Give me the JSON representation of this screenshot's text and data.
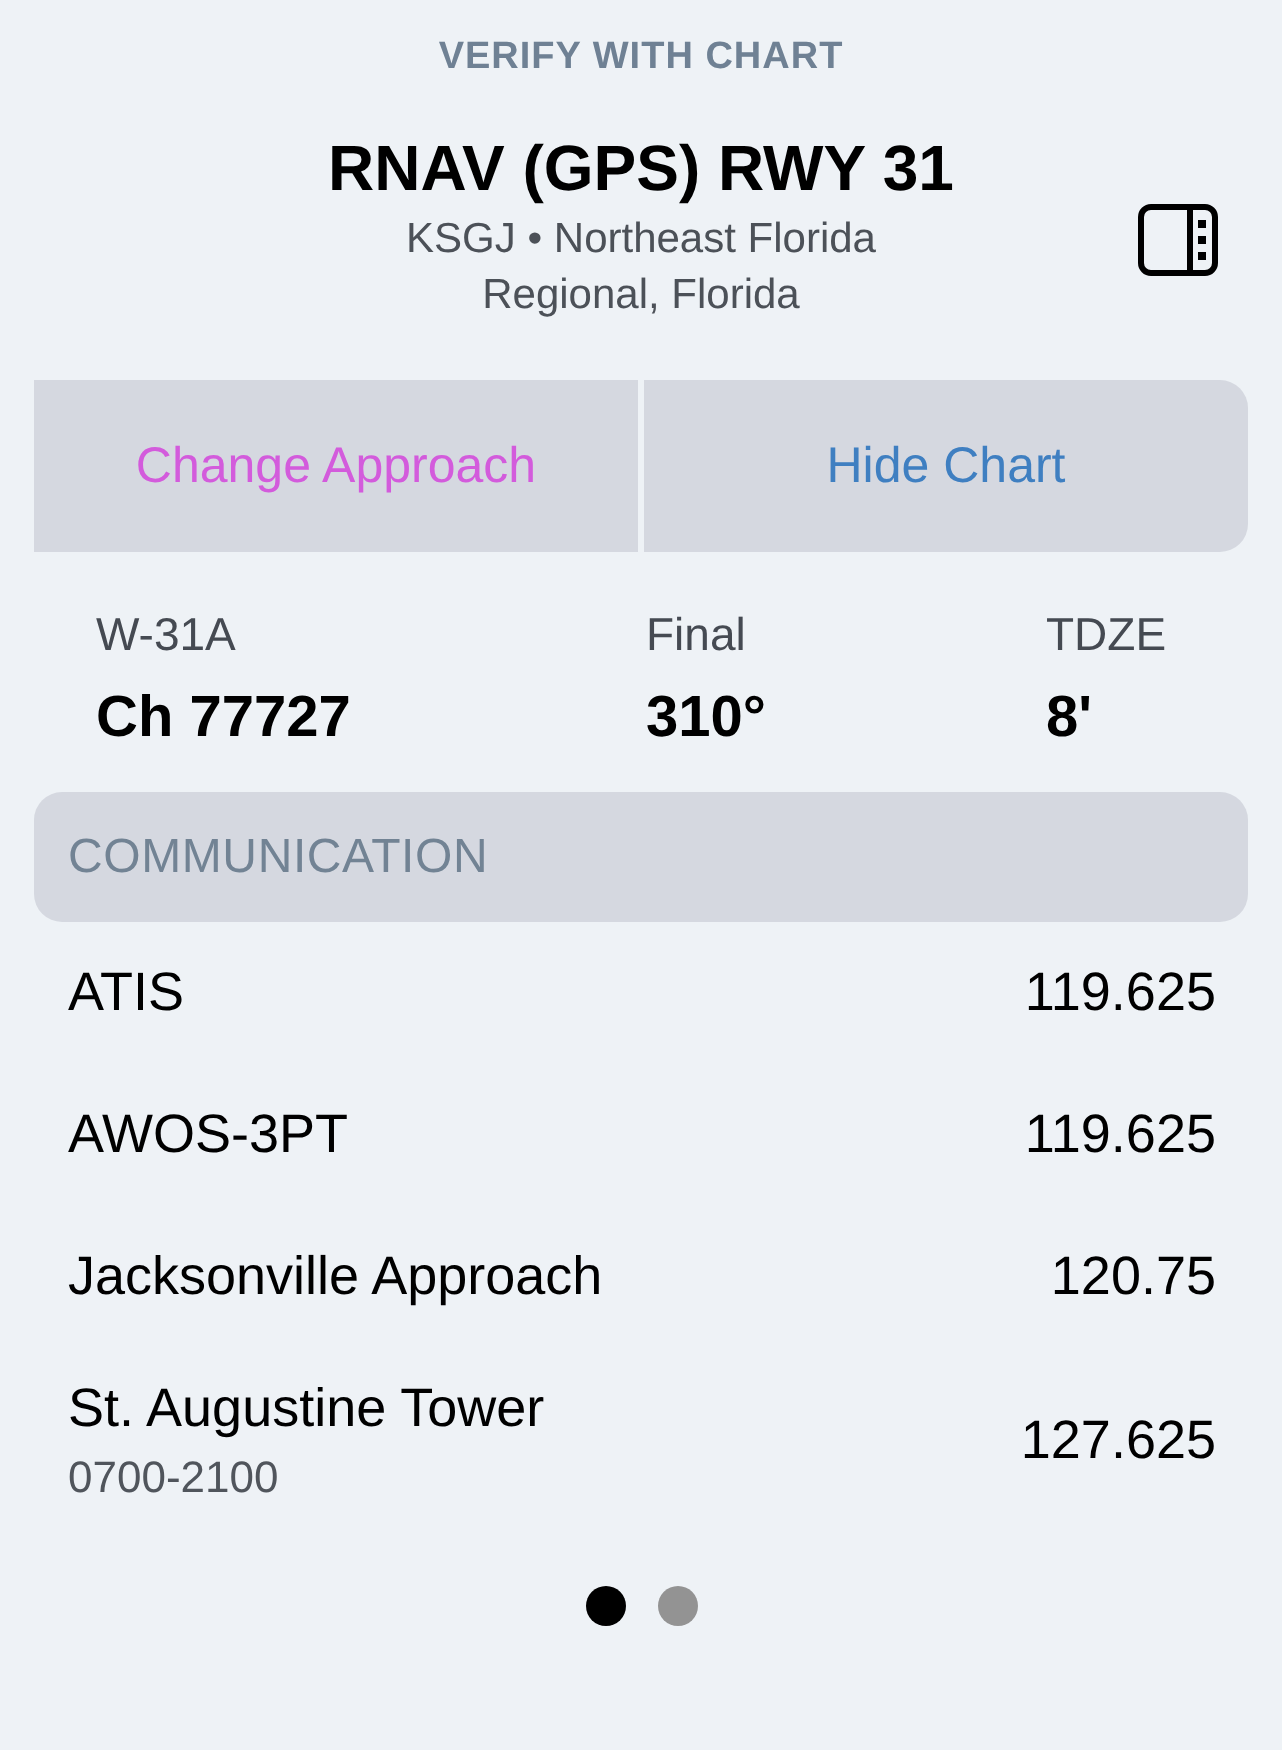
{
  "header": {
    "notice": "VERIFY WITH CHART",
    "title": "RNAV (GPS) RWY 31",
    "subtitle": "KSGJ • Northeast Florida Regional, Florida"
  },
  "actions": [
    {
      "label": "Change Approach",
      "color": "#d35bdc"
    },
    {
      "label": "Hide Chart",
      "color": "#3f7fc1"
    }
  ],
  "info": [
    {
      "label": "W-31A",
      "value": "Ch 77727"
    },
    {
      "label": "Final",
      "value": "310°"
    },
    {
      "label": "TDZE",
      "value": "8'"
    }
  ],
  "communication": {
    "title": "COMMUNICATION",
    "rows": [
      {
        "name": "ATIS",
        "frequency": "119.625"
      },
      {
        "name": "AWOS-3PT",
        "frequency": "119.625"
      },
      {
        "name": "Jacksonville Approach",
        "frequency": "120.75"
      },
      {
        "name": "St. Augustine Tower",
        "hours": "0700-2100",
        "frequency": "127.625"
      }
    ]
  },
  "pages": [
    {
      "selected": true
    },
    {
      "selected": false
    }
  ]
}
